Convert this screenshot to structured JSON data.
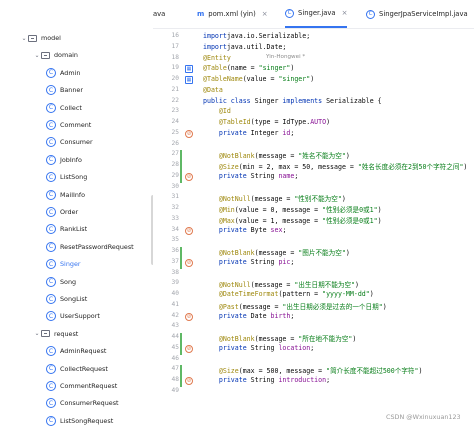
{
  "tabs": [
    {
      "label": "ava",
      "icon": "",
      "active": false
    },
    {
      "label": "pom.xml (yin)",
      "icon": "m",
      "active": false
    },
    {
      "label": "Singer.java",
      "icon": "C",
      "active": true
    },
    {
      "label": "SingerJpaServiceImpl.java",
      "icon": "C",
      "active": false
    }
  ],
  "tree": [
    {
      "label": "model",
      "kind": "folder",
      "expanded": true
    },
    {
      "label": "domain",
      "kind": "folder",
      "expanded": true
    },
    {
      "label": "Admin",
      "kind": "class"
    },
    {
      "label": "Banner",
      "kind": "class"
    },
    {
      "label": "Collect",
      "kind": "class"
    },
    {
      "label": "Comment",
      "kind": "class"
    },
    {
      "label": "Consumer",
      "kind": "class"
    },
    {
      "label": "JobInfo",
      "kind": "class"
    },
    {
      "label": "ListSong",
      "kind": "class"
    },
    {
      "label": "MailInfo",
      "kind": "class"
    },
    {
      "label": "Order",
      "kind": "class"
    },
    {
      "label": "RankList",
      "kind": "class"
    },
    {
      "label": "ResetPasswordRequest",
      "kind": "class"
    },
    {
      "label": "Singer",
      "kind": "class",
      "selected": true
    },
    {
      "label": "Song",
      "kind": "class"
    },
    {
      "label": "SongList",
      "kind": "class"
    },
    {
      "label": "UserSupport",
      "kind": "class"
    },
    {
      "label": "request",
      "kind": "folder",
      "expanded": true
    },
    {
      "label": "AdminRequest",
      "kind": "class"
    },
    {
      "label": "CollectRequest",
      "kind": "class"
    },
    {
      "label": "CommentRequest",
      "kind": "class"
    },
    {
      "label": "ConsumerRequest",
      "kind": "class"
    },
    {
      "label": "ListSongRequest",
      "kind": "class"
    }
  ],
  "author_hint": "Yin-Hongwei *",
  "lines": [
    {
      "n": "16",
      "t": [
        [
          "kw",
          "import"
        ],
        [
          "",
          "java.io.Serializable;"
        ]
      ]
    },
    {
      "n": "17",
      "t": [
        [
          "kw",
          "import"
        ],
        [
          "",
          "java.util.Date;"
        ]
      ]
    },
    {
      "n": "18",
      "t": [
        [
          "an",
          "@Entity"
        ]
      ]
    },
    {
      "n": "19",
      "t": [
        [
          "an",
          "@Table"
        ],
        [
          "",
          "(name = "
        ],
        [
          "st",
          "\"singer\""
        ],
        [
          "",
          ")"
        ]
      ]
    },
    {
      "n": "20",
      "t": [
        [
          "an",
          "@TableName"
        ],
        [
          "",
          "(value = "
        ],
        [
          "st",
          "\"singer\""
        ],
        [
          "",
          ")"
        ]
      ]
    },
    {
      "n": "21",
      "t": [
        [
          "an",
          "@Data"
        ]
      ]
    },
    {
      "n": "22",
      "t": [
        [
          "kw",
          "public class"
        ],
        [
          "",
          " Singer "
        ],
        [
          "kw",
          "implements"
        ],
        [
          "",
          " Serializable {"
        ]
      ]
    },
    {
      "n": "23",
      "t": [
        [
          "",
          "    "
        ],
        [
          "an",
          "@Id"
        ]
      ]
    },
    {
      "n": "24",
      "t": [
        [
          "",
          "    "
        ],
        [
          "an",
          "@TableId"
        ],
        [
          "",
          "(type = IdType."
        ],
        [
          "fd",
          "AUTO"
        ],
        [
          "",
          ")"
        ]
      ]
    },
    {
      "n": "25",
      "t": [
        [
          "",
          "    "
        ],
        [
          "kw",
          "private"
        ],
        [
          "",
          " Integer "
        ],
        [
          "fd",
          "id"
        ],
        [
          "",
          ";"
        ]
      ]
    },
    {
      "n": "26",
      "t": []
    },
    {
      "n": "27",
      "t": [
        [
          "",
          "    "
        ],
        [
          "an",
          "@NotBlank"
        ],
        [
          "",
          "(message = "
        ],
        [
          "st",
          "\"姓名不能为空\""
        ],
        [
          "",
          ")"
        ]
      ]
    },
    {
      "n": "28",
      "t": [
        [
          "",
          "    "
        ],
        [
          "an",
          "@Size"
        ],
        [
          "",
          "(min = 2, max = 50, message = "
        ],
        [
          "st",
          "\"姓名长度必须在2到50个字符之间\""
        ],
        [
          "",
          ")"
        ]
      ]
    },
    {
      "n": "29",
      "t": [
        [
          "",
          "    "
        ],
        [
          "kw",
          "private"
        ],
        [
          "",
          " String "
        ],
        [
          "fd",
          "name"
        ],
        [
          "",
          ";"
        ]
      ]
    },
    {
      "n": "30",
      "t": []
    },
    {
      "n": "31",
      "t": [
        [
          "",
          "    "
        ],
        [
          "an",
          "@NotNull"
        ],
        [
          "",
          "(message = "
        ],
        [
          "st",
          "\"性别不能为空\""
        ],
        [
          "",
          ")"
        ]
      ]
    },
    {
      "n": "32",
      "t": [
        [
          "",
          "    "
        ],
        [
          "an",
          "@Min"
        ],
        [
          "",
          "(value = 0, message = "
        ],
        [
          "st",
          "\"性别必须是0或1\""
        ],
        [
          "",
          ")"
        ]
      ]
    },
    {
      "n": "33",
      "t": [
        [
          "",
          "    "
        ],
        [
          "an",
          "@Max"
        ],
        [
          "",
          "(value = 1, message = "
        ],
        [
          "st",
          "\"性别必须是0或1\""
        ],
        [
          "",
          ")"
        ]
      ]
    },
    {
      "n": "34",
      "t": [
        [
          "",
          "    "
        ],
        [
          "kw",
          "private"
        ],
        [
          "",
          " Byte "
        ],
        [
          "fd",
          "sex"
        ],
        [
          "",
          ";"
        ]
      ]
    },
    {
      "n": "35",
      "t": []
    },
    {
      "n": "36",
      "t": [
        [
          "",
          "    "
        ],
        [
          "an",
          "@NotBlank"
        ],
        [
          "",
          "(message = "
        ],
        [
          "st",
          "\"图片不能为空\""
        ],
        [
          "",
          ")"
        ]
      ]
    },
    {
      "n": "37",
      "t": [
        [
          "",
          "    "
        ],
        [
          "kw",
          "private"
        ],
        [
          "",
          " String "
        ],
        [
          "fd",
          "pic"
        ],
        [
          "",
          ";"
        ]
      ]
    },
    {
      "n": "38",
      "t": []
    },
    {
      "n": "39",
      "t": [
        [
          "",
          "    "
        ],
        [
          "an",
          "@NotNull"
        ],
        [
          "",
          "(message = "
        ],
        [
          "st",
          "\"出生日期不能为空\""
        ],
        [
          "",
          ")"
        ]
      ]
    },
    {
      "n": "40",
      "t": [
        [
          "",
          "    "
        ],
        [
          "an",
          "@DateTimeFormat"
        ],
        [
          "",
          "(pattern = "
        ],
        [
          "st",
          "\"yyyy-MM-dd\""
        ],
        [
          "",
          ")"
        ]
      ]
    },
    {
      "n": "41",
      "t": [
        [
          "",
          "    "
        ],
        [
          "an",
          "@Past"
        ],
        [
          "",
          "(message = "
        ],
        [
          "st",
          "\"出生日期必须是过去的一个日期\""
        ],
        [
          "",
          ")"
        ]
      ]
    },
    {
      "n": "42",
      "t": [
        [
          "",
          "    "
        ],
        [
          "kw",
          "private"
        ],
        [
          "",
          " Date "
        ],
        [
          "fd",
          "birth"
        ],
        [
          "",
          ";"
        ]
      ]
    },
    {
      "n": "43",
      "t": []
    },
    {
      "n": "44",
      "t": [
        [
          "",
          "    "
        ],
        [
          "an",
          "@NotBlank"
        ],
        [
          "",
          "(message = "
        ],
        [
          "st",
          "\"所在地不能为空\""
        ],
        [
          "",
          ")"
        ]
      ]
    },
    {
      "n": "45",
      "t": [
        [
          "",
          "    "
        ],
        [
          "kw",
          "private"
        ],
        [
          "",
          " String "
        ],
        [
          "fd",
          "location"
        ],
        [
          "",
          ";"
        ]
      ]
    },
    {
      "n": "46",
      "t": []
    },
    {
      "n": "47",
      "t": [
        [
          "",
          "    "
        ],
        [
          "an",
          "@Size"
        ],
        [
          "",
          "(max = 500, message = "
        ],
        [
          "st",
          "\"简介长度不能超过500个字符\""
        ],
        [
          "",
          ")"
        ]
      ]
    },
    {
      "n": "48",
      "t": [
        [
          "",
          "    "
        ],
        [
          "kw",
          "private"
        ],
        [
          "",
          " String "
        ],
        [
          "fd",
          "introduction"
        ],
        [
          "",
          ";"
        ]
      ]
    },
    {
      "n": "49",
      "t": []
    }
  ],
  "gutter_icons": {
    "19": "grid",
    "20": "grid",
    "25": "dot",
    "29": "dot",
    "34": "dot",
    "37": "dot",
    "42": "dot",
    "45": "dot",
    "48": "dot"
  },
  "changed_lines": [
    "27",
    "28",
    "29",
    "36",
    "37",
    "44",
    "45",
    "47",
    "48"
  ],
  "watermark": "CSDN @Wxinuxuan123"
}
